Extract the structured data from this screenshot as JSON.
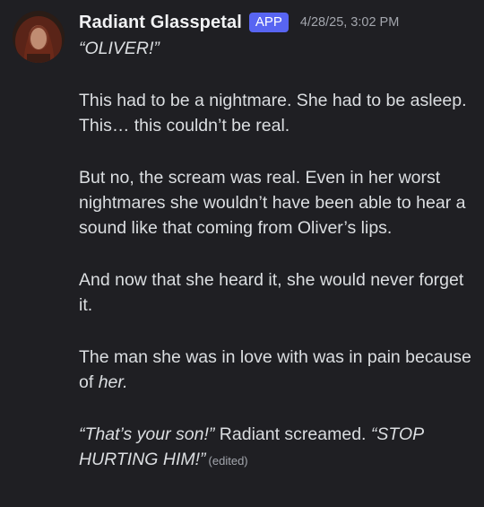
{
  "message": {
    "author": "Radiant Glasspetal",
    "badge": "APP",
    "timestamp": "4/28/25, 3:02 PM",
    "avatar_icon": "character-portrait-avatar",
    "edited_label": "(edited)",
    "paragraphs": {
      "p1": "“OLIVER!”",
      "p2": "This had to be a nightmare. She had to be asleep. This… this couldn’t be real.",
      "p3": "But no, the scream was real. Even in her worst nightmares she wouldn’t have been able to hear a sound like that coming from Oliver’s lips.",
      "p4": "And now that she heard it, she would never forget it.",
      "p5_a": "The man she was in love with was in pain because of ",
      "p5_b": "her.",
      "p6_a": "“That’s your son!”",
      "p6_b": " Radiant screamed. ",
      "p6_c": "“STOP HURTING HIM!”"
    }
  },
  "colors": {
    "background": "#1f1f23",
    "text": "#dbdee1",
    "username": "#f2f3f5",
    "badge": "#5865f2",
    "muted": "#a3a6ad"
  }
}
